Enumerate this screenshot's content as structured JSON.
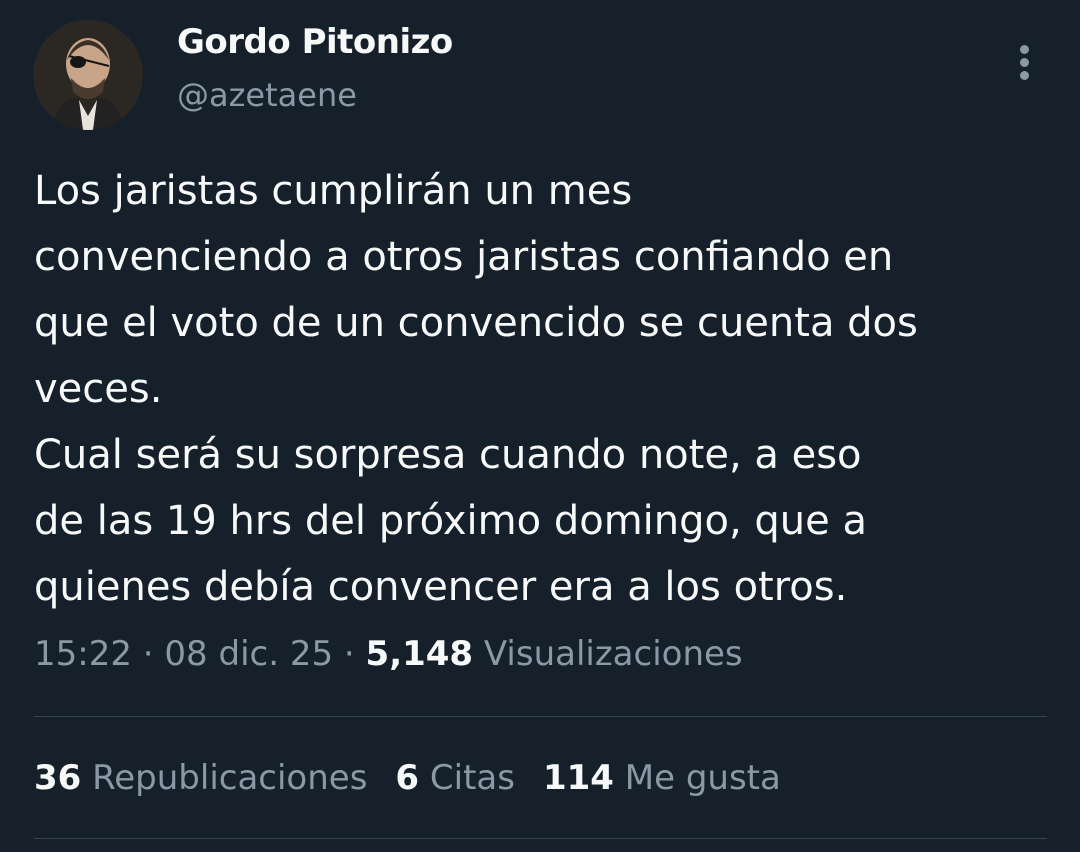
{
  "author": {
    "name": "Gordo Pitonizo",
    "handle": "@azetaene"
  },
  "tweet": {
    "lines": [
      "Los jaristas cumplirán un mes",
      "convenciendo a otros jaristas confiando en",
      "que el voto de un convencido se cuenta dos",
      "veces.",
      "Cual será su sorpresa cuando note, a eso",
      "de las 19 hrs del próximo domingo, que a",
      "quienes debía convencer era a los otros."
    ]
  },
  "meta": {
    "time": "15:22",
    "date": "08 dic. 25",
    "views_count": "5,148",
    "views_label": "Visualizaciones"
  },
  "stats": {
    "reposts_count": "36",
    "reposts_label": "Republicaciones",
    "quotes_count": "6",
    "quotes_label": "Citas",
    "likes_count": "114",
    "likes_label": "Me gusta"
  },
  "icons": {
    "more": "more-vertical-icon"
  },
  "colors": {
    "background": "#15202b",
    "primary_text": "#f7f9f9",
    "secondary_text": "#8b98a5",
    "divider": "#38444d"
  }
}
